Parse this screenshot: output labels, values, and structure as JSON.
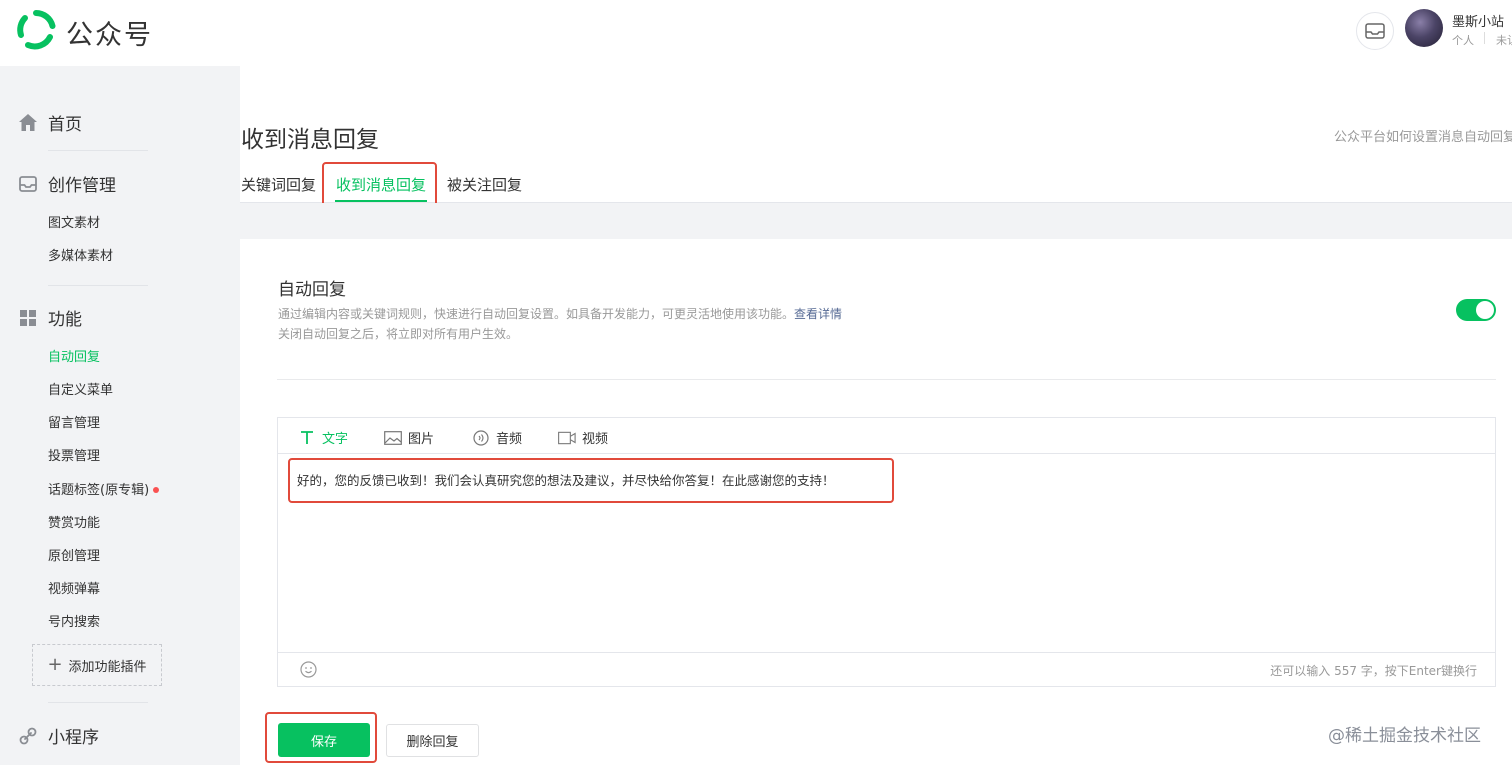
{
  "header": {
    "brand": "公众号",
    "account_name": "墨斯小站",
    "account_type": "个人",
    "account_status": "未认"
  },
  "sidebar": {
    "home": "首页",
    "creation": {
      "label": "创作管理",
      "items": [
        "图文素材",
        "多媒体素材"
      ]
    },
    "features": {
      "label": "功能",
      "items": [
        "自动回复",
        "自定义菜单",
        "留言管理",
        "投票管理",
        "话题标签(原专辑)",
        "赞赏功能",
        "原创管理",
        "视频弹幕",
        "号内搜索"
      ],
      "active": "自动回复"
    },
    "add_plugin": "添加功能插件",
    "mini_program": "小程序"
  },
  "main": {
    "title": "收到消息回复",
    "help_link": "公众平台如何设置消息自动回复",
    "tabs": [
      "关键词回复",
      "收到消息回复",
      "被关注回复"
    ],
    "active_tab": "收到消息回复",
    "auto_reply": {
      "title": "自动回复",
      "desc_line1": "通过编辑内容或关键词规则，快速进行自动回复设置。如具备开发能力，可更灵活地使用该功能。",
      "desc_link": "查看详情",
      "desc_line2": "关闭自动回复之后，将立即对所有用户生效。",
      "enabled": true
    },
    "editor": {
      "tools": [
        "文字",
        "图片",
        "音频",
        "视频"
      ],
      "active_tool": "文字",
      "content": "好的，您的反馈已收到！我们会认真研究您的想法及建议，并尽快给你答复！在此感谢您的支持！",
      "char_count": "还可以输入 557 字，按下Enter键换行"
    },
    "save_button": "保存",
    "delete_button": "删除回复"
  },
  "watermark": "@稀土掘金技术社区",
  "colors": {
    "accent": "#07c160",
    "highlight": "#e14a3b",
    "link": "#576b95",
    "badge": "#fa5151"
  }
}
